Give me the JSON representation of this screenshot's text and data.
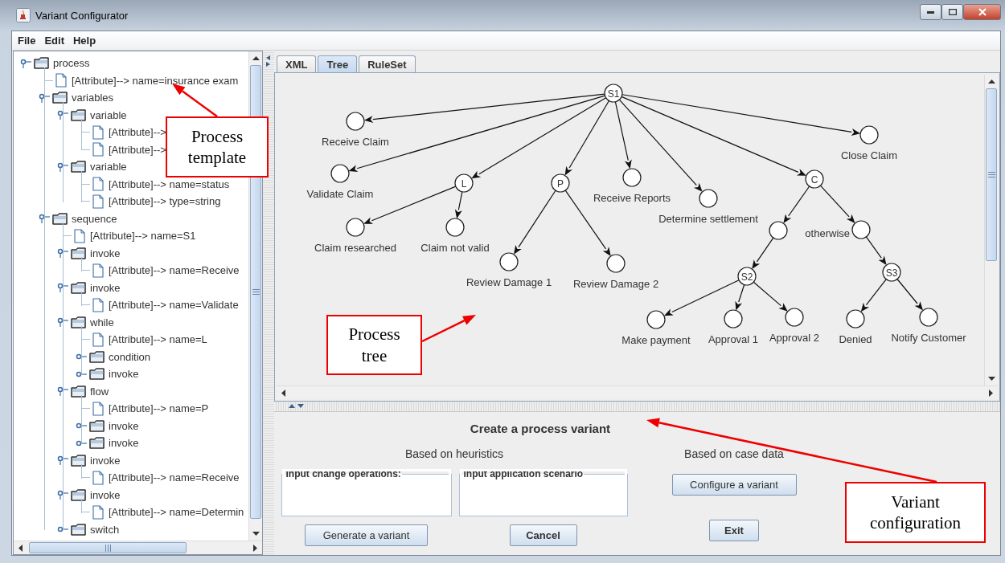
{
  "window": {
    "title": "Variant Configurator"
  },
  "menu": [
    "File",
    "Edit",
    "Help"
  ],
  "template_tree": [
    {
      "kind": "folder",
      "label": "process",
      "expanded": true,
      "children": [
        {
          "kind": "attribute",
          "label": "[Attribute]--> name=insurance exam"
        },
        {
          "kind": "folder",
          "label": "variables",
          "expanded": true,
          "children": [
            {
              "kind": "folder",
              "label": "variable",
              "expanded": true,
              "children": [
                {
                  "kind": "attribute",
                  "label": "[Attribute]-->"
                },
                {
                  "kind": "attribute",
                  "label": "[Attribute]-->"
                }
              ]
            },
            {
              "kind": "folder",
              "label": "variable",
              "expanded": true,
              "children": [
                {
                  "kind": "attribute",
                  "label": "[Attribute]--> name=status"
                },
                {
                  "kind": "attribute",
                  "label": "[Attribute]--> type=string"
                }
              ]
            }
          ]
        },
        {
          "kind": "folder",
          "label": "sequence",
          "expanded": true,
          "children": [
            {
              "kind": "attribute",
              "label": "[Attribute]--> name=S1"
            },
            {
              "kind": "folder",
              "label": "invoke",
              "expanded": true,
              "children": [
                {
                  "kind": "attribute",
                  "label": "[Attribute]--> name=Receive"
                }
              ]
            },
            {
              "kind": "folder",
              "label": "invoke",
              "expanded": true,
              "children": [
                {
                  "kind": "attribute",
                  "label": "[Attribute]--> name=Validate"
                }
              ]
            },
            {
              "kind": "folder",
              "label": "while",
              "expanded": true,
              "children": [
                {
                  "kind": "attribute",
                  "label": "[Attribute]--> name=L"
                },
                {
                  "kind": "folder",
                  "label": "condition",
                  "expanded": false
                },
                {
                  "kind": "folder",
                  "label": "invoke",
                  "expanded": false
                }
              ]
            },
            {
              "kind": "folder",
              "label": "flow",
              "expanded": true,
              "children": [
                {
                  "kind": "attribute",
                  "label": "[Attribute]--> name=P"
                },
                {
                  "kind": "folder",
                  "label": "invoke",
                  "expanded": false
                },
                {
                  "kind": "folder",
                  "label": "invoke",
                  "expanded": false
                }
              ]
            },
            {
              "kind": "folder",
              "label": "invoke",
              "expanded": true,
              "children": [
                {
                  "kind": "attribute",
                  "label": "[Attribute]--> name=Receive"
                }
              ]
            },
            {
              "kind": "folder",
              "label": "invoke",
              "expanded": true,
              "children": [
                {
                  "kind": "attribute",
                  "label": "[Attribute]--> name=Determin"
                }
              ]
            },
            {
              "kind": "folder",
              "label": "switch",
              "expanded": false
            }
          ]
        }
      ]
    }
  ],
  "tabs": [
    {
      "label": "XML",
      "selected": false
    },
    {
      "label": "Tree",
      "selected": true
    },
    {
      "label": "RuleSet",
      "selected": false
    }
  ],
  "process_tree": {
    "symbol": "S1",
    "children": [
      {
        "label": "Receive Claim"
      },
      {
        "label": "Validate Claim"
      },
      {
        "symbol": "L",
        "children": [
          {
            "label": "Claim researched"
          },
          {
            "label": "Claim not valid"
          }
        ]
      },
      {
        "symbol": "P",
        "children": [
          {
            "label": "Review Damage 1"
          },
          {
            "label": "Review Damage 2"
          }
        ]
      },
      {
        "label": "Receive Reports"
      },
      {
        "label": "Determine settlement"
      },
      {
        "symbol": "C",
        "children": [
          {
            "children": [
              {
                "symbol": "S2",
                "children": [
                  {
                    "label": "Make payment"
                  },
                  {
                    "label": "Approval 1"
                  },
                  {
                    "label": "Approval 2"
                  }
                ]
              }
            ]
          },
          {
            "label": "otherwise",
            "children": [
              {
                "symbol": "S3",
                "children": [
                  {
                    "label": "Denied"
                  },
                  {
                    "label": "Notify Customer"
                  }
                ]
              }
            ]
          }
        ]
      },
      {
        "label": "Close Claim"
      }
    ]
  },
  "variant_panel": {
    "title": "Create a process variant",
    "heuristics": {
      "heading": "Based on heuristics",
      "fields": [
        {
          "label": "Input change operations:",
          "button": {
            "label": "Generate a variant",
            "kind": "plain"
          }
        },
        {
          "label": "Input application scenario",
          "button": {
            "label": "Cancel",
            "kind": "strong"
          }
        }
      ]
    },
    "case_data": {
      "heading": "Based on case data",
      "buttons": [
        {
          "label": "Configure a variant",
          "kind": "plain"
        },
        {
          "label": "Exit",
          "kind": "strong"
        }
      ]
    }
  },
  "annotations": [
    {
      "text": "Process\ntemplate"
    },
    {
      "text": "Process\ntree"
    },
    {
      "text": "Variant\nconfiguration"
    }
  ]
}
